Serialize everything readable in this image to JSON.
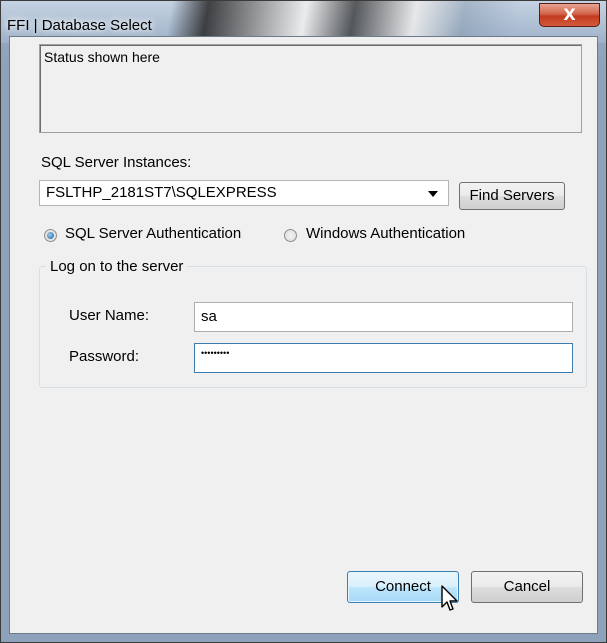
{
  "window": {
    "title": "FFI | Database Select",
    "close_label": "X"
  },
  "status": {
    "text": "Status shown here"
  },
  "server": {
    "label": "SQL Server Instances:",
    "selected_instance": "FSLTHP_2181ST7\\SQLEXPRESS",
    "find_button": "Find Servers"
  },
  "auth": {
    "sql_label": "SQL Server Authentication",
    "windows_label": "Windows Authentication",
    "selected": "sql"
  },
  "logon": {
    "group_title": "Log on to the server",
    "username_label": "User Name:",
    "username_value": "sa",
    "password_label": "Password:",
    "password_value": "•••••••••"
  },
  "actions": {
    "connect": "Connect",
    "cancel": "Cancel"
  },
  "colors": {
    "accent": "#3c7fb1",
    "close": "#c23b1f"
  }
}
